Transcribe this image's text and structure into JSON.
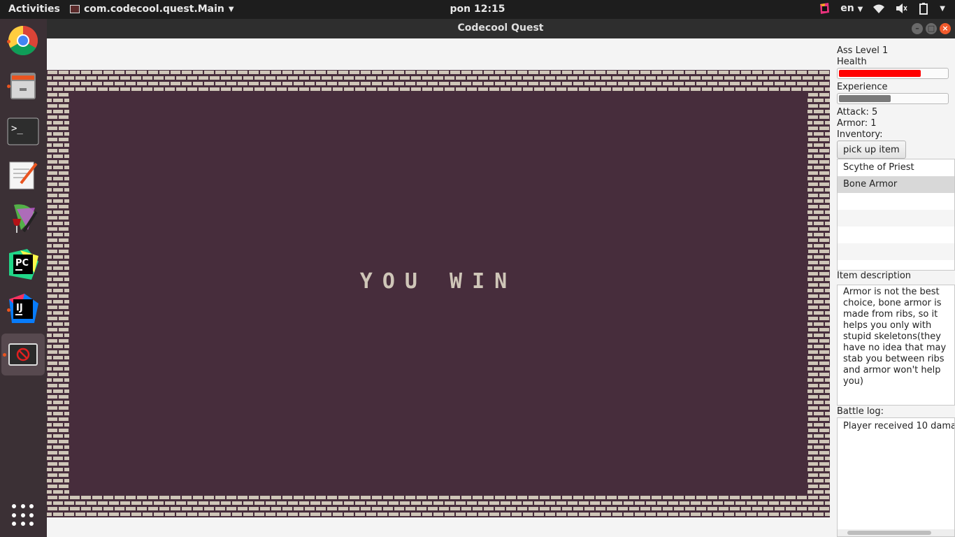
{
  "topbar": {
    "activities": "Activities",
    "app_name": "com.codecool.quest.Main",
    "clock": "pon 12:15",
    "lang": "en"
  },
  "window": {
    "title": "Codecool Quest"
  },
  "game": {
    "message": "YOU WIN",
    "colors": {
      "floor": "#472d3c",
      "wall_brick": "#cfc6b8",
      "wall_mortar": "#472d3c"
    }
  },
  "sidebar": {
    "level_label": "Ass Level 1",
    "health_label": "Health",
    "health_fraction": 0.76,
    "experience_label": "Experience",
    "experience_fraction": 0.48,
    "attack": "Attack: 5",
    "armor": "Armor: 1",
    "inventory_label": "Inventory:",
    "pick_button": "pick up item",
    "inventory_items": [
      "Scythe of Priest",
      "Bone Armor"
    ],
    "item_description_label": "Item description",
    "item_description": "Armor is not the best choice, bone armor is made from ribs, so it helps you only with stupid skeletons(they have no idea that may stab you between ribs and armor won't help you)",
    "battle_log_label": "Battle log:",
    "battle_log": "Player received 10 dama",
    "colors": {
      "health": "#ff0000",
      "experience": "#7a7a7a"
    }
  },
  "dock": {
    "icons": [
      "chrome-icon",
      "files-icon",
      "terminal-icon",
      "text-editor-icon",
      "wine-icon",
      "pycharm-icon",
      "intellij-icon",
      "java-app-icon"
    ]
  }
}
